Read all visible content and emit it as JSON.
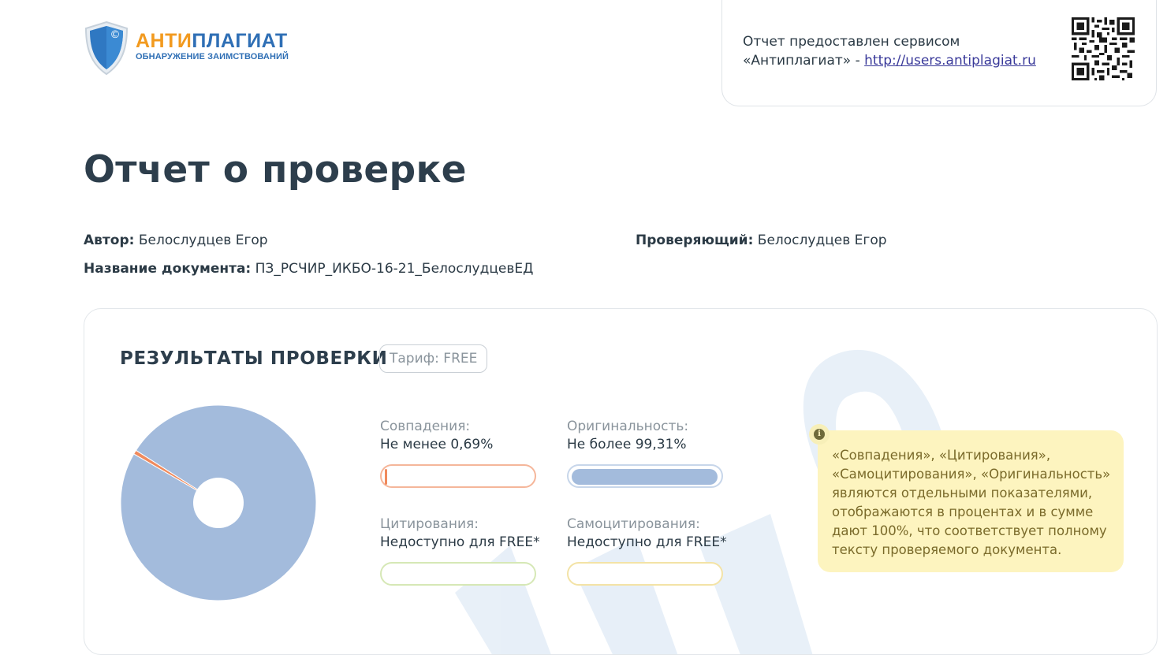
{
  "header": {
    "logo_brand_part1": "АНТИ",
    "logo_brand_part2": "ПЛАГИАТ",
    "logo_tagline": "ОБНАРУЖЕНИЕ ЗАИМСТВОВАНИЙ",
    "logo_shield_glyph": "©",
    "provided_line1": "Отчет предоставлен сервисом",
    "provided_line2_prefix": "«Антиплагиат» - ",
    "provided_link": "http://users.antiplagiat.ru"
  },
  "page": {
    "title": "Отчет о проверке"
  },
  "meta": {
    "author_label": "Автор:",
    "author_value": "Белослудцев Егор",
    "checker_label": "Проверяющий:",
    "checker_value": "Белослудцев Егор",
    "doc_label": "Название документа:",
    "doc_value": "ПЗ_РСЧИР_ИКБО-16-21_БелослудцевЕД"
  },
  "results": {
    "heading": "РЕЗУЛЬТАТЫ ПРОВЕРКИ",
    "tariff": "Тариф: FREE",
    "metrics": {
      "matches": {
        "label": "Совпадения:",
        "value": "Не менее 0,69%",
        "percent": 0.69,
        "color": "#f08a5d"
      },
      "originality": {
        "label": "Оригинальность:",
        "value": "Не более 99,31%",
        "percent": 99.31,
        "color": "#a3bbdc"
      },
      "citations": {
        "label": "Цитирования:",
        "value": "Недоступно для FREE*",
        "color": "#c9e2a0"
      },
      "self_citations": {
        "label": "Самоцитирования:",
        "value": "Недоступно для FREE*",
        "color": "#f3dd8a"
      }
    },
    "info_text": "«Совпадения», «Цитирования», «Самоцитирования», «Оригинальность» являются отдельными показателями, отображаются в процентах и в сумме дают 100%, что соответствует полному тексту проверяемого документа.",
    "info_icon": "info-icon"
  },
  "chart_data": {
    "type": "pie",
    "categories": [
      "Совпадения",
      "Оригинальность"
    ],
    "values": [
      0.69,
      99.31
    ],
    "colors": [
      "#f08a5d",
      "#a3bbdc"
    ]
  }
}
